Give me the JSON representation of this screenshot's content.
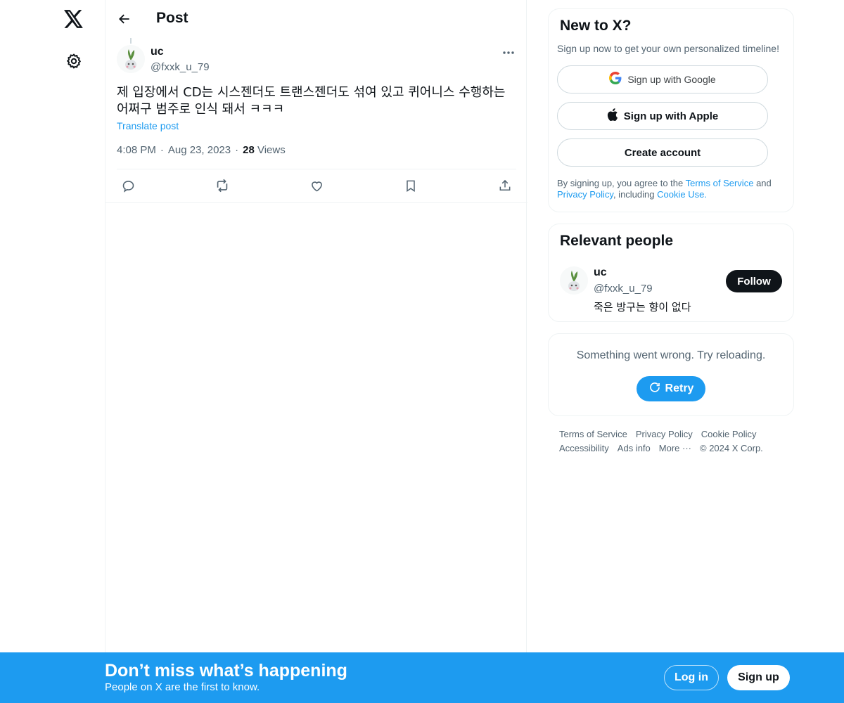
{
  "colors": {
    "accent": "#1d9bf0",
    "text": "#0f1419",
    "muted": "#536471",
    "border": "#eff3f4"
  },
  "nav": {
    "logo_icon": "x-logo-icon",
    "settings_icon": "gear-icon"
  },
  "header": {
    "title": "Post",
    "back_icon": "arrow-left-icon"
  },
  "post": {
    "author_name": "uc",
    "author_handle": "@fxxk_u_79",
    "text": "제 입장에서 CD는 시스젠더도 트랜스젠더도 섞여 있고 퀴어니스 수행하는 어쩌구 범주로 인식 돼서 ㅋㅋㅋ",
    "translate_label": "Translate post",
    "time": "4:08 PM",
    "date": "Aug 23, 2023",
    "views_count": "28",
    "views_label": "Views",
    "dot": "·",
    "actions": [
      "reply-icon",
      "repost-icon",
      "like-icon",
      "bookmark-icon",
      "share-icon"
    ]
  },
  "signup_card": {
    "title": "New to X?",
    "subtitle": "Sign up now to get your own personalized timeline!",
    "google_label": "Sign up with Google",
    "apple_label": "Sign up with Apple",
    "create_label": "Create account",
    "legal_prefix": "By signing up, you agree to the",
    "terms_label": "Terms of Service",
    "and": "and",
    "privacy_label": "Privacy Policy",
    "including": ", including",
    "cookie_label": "Cookie Use."
  },
  "relevant": {
    "title": "Relevant people",
    "name": "uc",
    "handle": "@fxxk_u_79",
    "bio": "죽은 방구는 향이 없다",
    "follow_label": "Follow"
  },
  "error_card": {
    "message": "Something went wrong. Try reloading.",
    "retry_label": "Retry"
  },
  "footer": {
    "terms": "Terms of Service",
    "privacy": "Privacy Policy",
    "cookie": "Cookie Policy",
    "accessibility": "Accessibility",
    "ads": "Ads info",
    "more": "More ···",
    "copyright": "© 2024 X Corp."
  },
  "bottom_bar": {
    "title": "Don’t miss what’s happening",
    "subtitle": "People on X are the first to know.",
    "login_label": "Log in",
    "signup_label": "Sign up"
  }
}
